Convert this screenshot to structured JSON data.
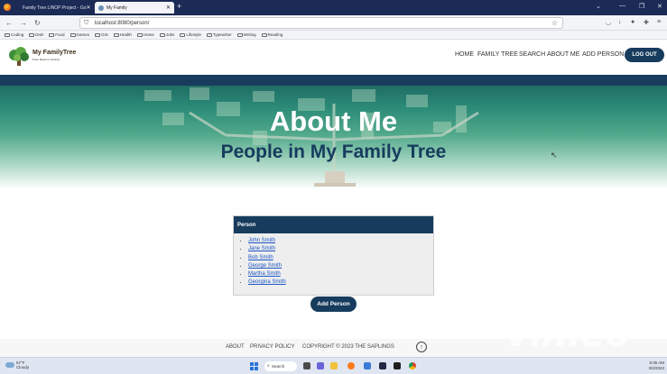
{
  "browser": {
    "tabs": [
      {
        "title": "Family Tree LINOP Project - Go",
        "active": false
      },
      {
        "title": "My Family",
        "active": true
      }
    ],
    "new_tab": "+",
    "url": "localhost:8080/person/",
    "bookmarks": [
      "Coding",
      "DnD",
      "Food",
      "Games",
      "GIS",
      "Health",
      "Home",
      "Jobs",
      "Lifestyle",
      "Typewriter",
      "Writing",
      "Reading"
    ]
  },
  "site": {
    "logo": {
      "name": "My FamilyTree",
      "tagline": "From Roots to Crowns"
    },
    "nav": [
      "HOME",
      "FAMILY TREE",
      "SEARCH",
      "ABOUT ME",
      "ADD PERSON"
    ],
    "logout_label": "LOG OUT"
  },
  "hero": {
    "title": "About Me",
    "subtitle": "People in My Family Tree"
  },
  "person_card": {
    "header": "Person",
    "people": [
      "John Smith",
      "Jane Smith",
      "Bob Smith",
      "George Smith",
      "Martha Smith",
      "Georgina Smith"
    ]
  },
  "add_person_label": "Add Person",
  "footer": {
    "about": "ABOUT",
    "privacy": "PRIVACY POLICY",
    "copyright": "COPYRIGHT © 2023 THE SAPLINGS"
  },
  "watermark": "vimeo",
  "taskbar": {
    "weather_temp": "57°F",
    "weather_desc": "Cloudy",
    "search_label": "Search",
    "time": "8:35 AM",
    "date": "3/2/2023"
  },
  "colors": {
    "brand_navy": "#173c5e",
    "link_blue": "#1a55c4",
    "browser_chrome": "#1c2b56"
  },
  "icons": {
    "back": "arrow-left-icon",
    "forward": "arrow-right-icon",
    "reload": "reload-icon",
    "bookmark": "star-icon",
    "scroll_top": "arrow-up-icon"
  }
}
